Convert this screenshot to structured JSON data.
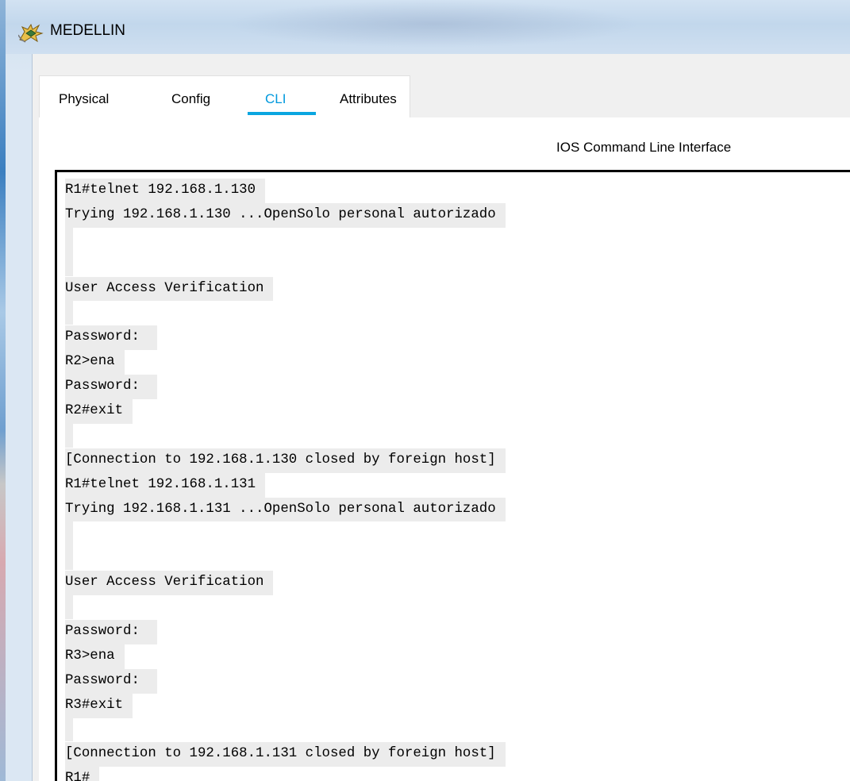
{
  "window": {
    "title": "MEDELLIN",
    "icon": "router-app-icon"
  },
  "tabs": [
    {
      "label": "Physical",
      "active": false
    },
    {
      "label": "Config",
      "active": false
    },
    {
      "label": "CLI",
      "active": true
    },
    {
      "label": "Attributes",
      "active": false
    }
  ],
  "cli": {
    "heading": "IOS Command Line Interface",
    "lines": [
      "R1#telnet 192.168.1.130",
      "Trying 192.168.1.130 ...OpenSolo personal autorizado",
      "",
      "",
      "User Access Verification",
      "",
      "Password: ",
      "R2>ena",
      "Password: ",
      "R2#exit",
      "",
      "[Connection to 192.168.1.130 closed by foreign host]",
      "R1#telnet 192.168.1.131",
      "Trying 192.168.1.131 ...OpenSolo personal autorizado",
      "",
      "",
      "User Access Verification",
      "",
      "Password: ",
      "R3>ena",
      "Password: ",
      "R3#exit",
      "",
      "[Connection to 192.168.1.131 closed by foreign host]",
      "R1#"
    ]
  },
  "colors": {
    "active_tab": "#0099dd",
    "tab_underline": "#0aa6e0",
    "terminal_border": "#000000",
    "line_highlight": "#ececec"
  }
}
